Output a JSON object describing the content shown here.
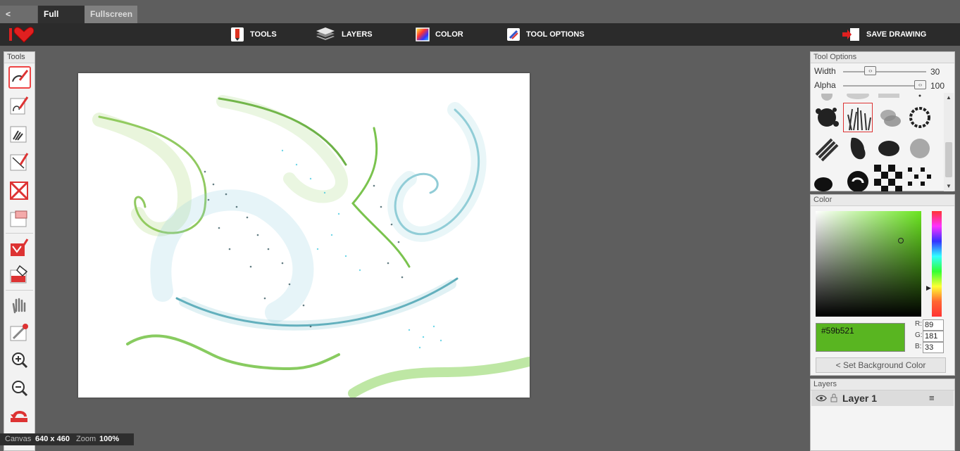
{
  "nav": {
    "back": "< Back",
    "full_view": "Full view",
    "fullscreen": "Fullscreen"
  },
  "toolbar": {
    "tools": "TOOLS",
    "layers": "LAYERS",
    "color": "COLOR",
    "tool_options": "TOOL OPTIONS",
    "save": "SAVE DRAWING"
  },
  "tools_panel": {
    "title": "Tools"
  },
  "tool_options": {
    "title": "Tool Options",
    "width_label": "Width",
    "width_value": "30",
    "alpha_label": "Alpha",
    "alpha_value": "100",
    "width_level": 0.3,
    "alpha_level": 1.0
  },
  "color_panel": {
    "title": "Color",
    "hex": "#59b521",
    "r_label": "R:",
    "g_label": "G:",
    "b_label": "B:",
    "r": "89",
    "g": "181",
    "b": "33",
    "bg_button": "< Set Background Color",
    "current_color": "#59b521"
  },
  "layers_panel": {
    "title": "Layers",
    "layer_name": "Layer 1"
  },
  "status": {
    "canvas_label": "Canvas",
    "canvas_size": "640 x 460",
    "zoom_label": "Zoom",
    "zoom_value": "100%"
  },
  "icons": [
    "heart-logo-icon",
    "pencil-icon",
    "layers-icon",
    "color-icon",
    "tool-options-icon",
    "save-icon",
    "eye-icon",
    "lock-icon",
    "menu-icon"
  ]
}
